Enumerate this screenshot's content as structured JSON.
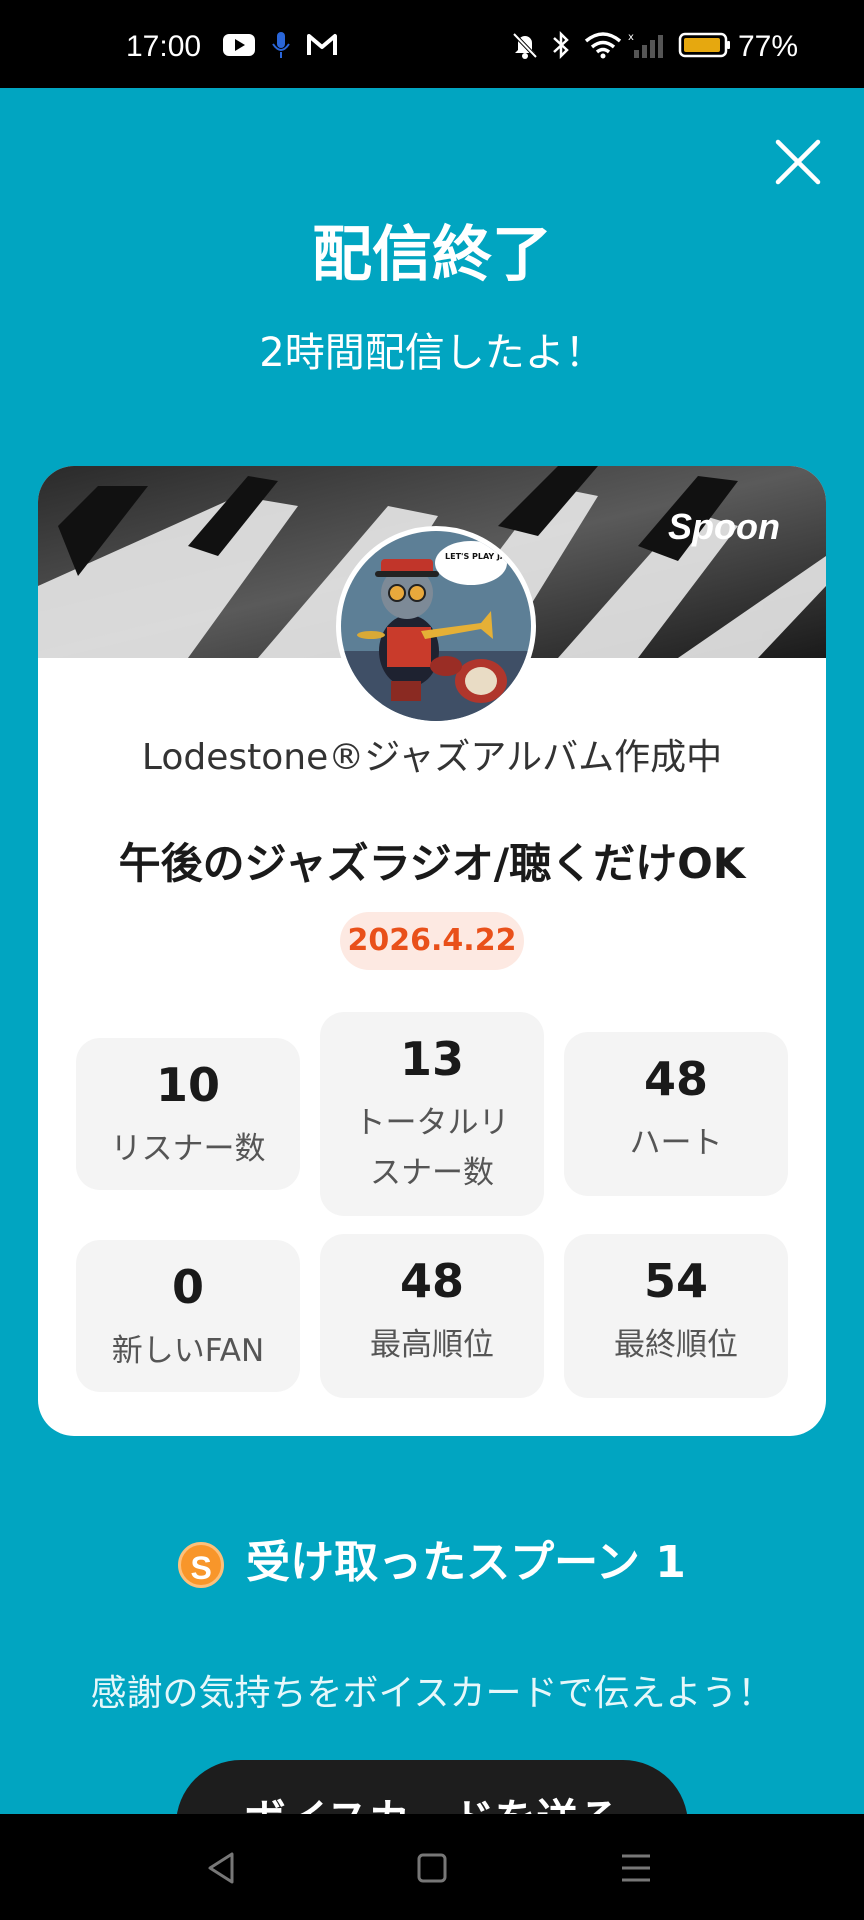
{
  "status_bar": {
    "time": "17:00",
    "battery_percent": "77%",
    "icons": [
      "youtube-icon",
      "mic-icon",
      "gmail-icon",
      "mute-icon",
      "bluetooth-icon",
      "wifi-icon",
      "signal-icon",
      "battery-icon"
    ]
  },
  "header": {
    "title": "配信終了",
    "subtitle": "2時間配信したよ！"
  },
  "card": {
    "brand": "Spoon",
    "host_name": "Lodestone®ジャズアルバム作成中",
    "show_title": "午後のジャズラジオ/聴くだけOK",
    "date": "2026.4.22",
    "avatar_text": "LET'S PLAY JAZZ, NOT WAR.",
    "stats": [
      {
        "value": "10",
        "label": "リスナー数"
      },
      {
        "value": "13",
        "label": "トータルリスナー数"
      },
      {
        "value": "48",
        "label": "ハート"
      },
      {
        "value": "0",
        "label": "新しいFAN"
      },
      {
        "value": "48",
        "label": "最高順位"
      },
      {
        "value": "54",
        "label": "最終順位"
      }
    ]
  },
  "spoons": {
    "coin_symbol": "S",
    "label": "受け取ったスプーン 1"
  },
  "thanks_message": "感謝の気持ちをボイスカードで伝えよう！",
  "voice_card_button": "ボイスカードを送る",
  "colors": {
    "background": "#01a5c1",
    "date_text": "#e9501a",
    "date_bg": "#fde9e2",
    "coin": "#f8962a"
  }
}
